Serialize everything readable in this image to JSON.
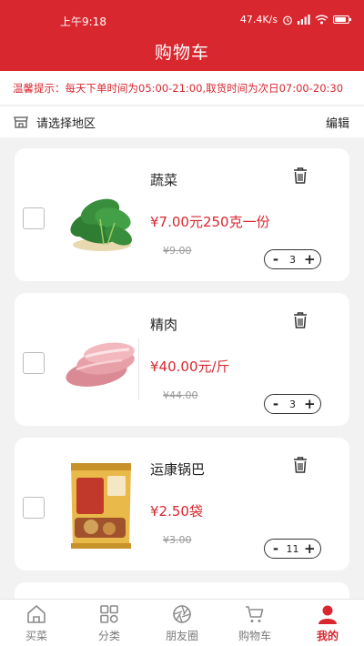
{
  "status": {
    "time": "上午9:18",
    "speed": "47.4K/s"
  },
  "header": {
    "title": "购物车"
  },
  "notice": {
    "text": "温馨提示：每天下单时间为05:00-21:00,取货时间为次日07:00-20:30"
  },
  "region": {
    "label": "请选择地区",
    "edit_label": "编辑"
  },
  "items": [
    {
      "name": "蔬菜",
      "price": "¥7.00元250克一份",
      "old_price": "¥9.00",
      "quantity": "3"
    },
    {
      "name": "精肉",
      "price": "¥40.00元/斤",
      "old_price": "¥44.00",
      "quantity": "3"
    },
    {
      "name": "运康锅巴",
      "price": "¥2.50袋",
      "old_price": "¥3.00",
      "quantity": "11"
    }
  ],
  "stepper": {
    "minus": "-",
    "plus": "+"
  },
  "tabs": [
    {
      "label": "买菜",
      "icon": "home-icon"
    },
    {
      "label": "分类",
      "icon": "category-icon"
    },
    {
      "label": "朋友圈",
      "icon": "aperture-icon"
    },
    {
      "label": "购物车",
      "icon": "cart-icon"
    },
    {
      "label": "我的",
      "icon": "user-icon",
      "active": true
    }
  ],
  "colors": {
    "brand": "#d8272f",
    "background": "#f2f2f2"
  }
}
